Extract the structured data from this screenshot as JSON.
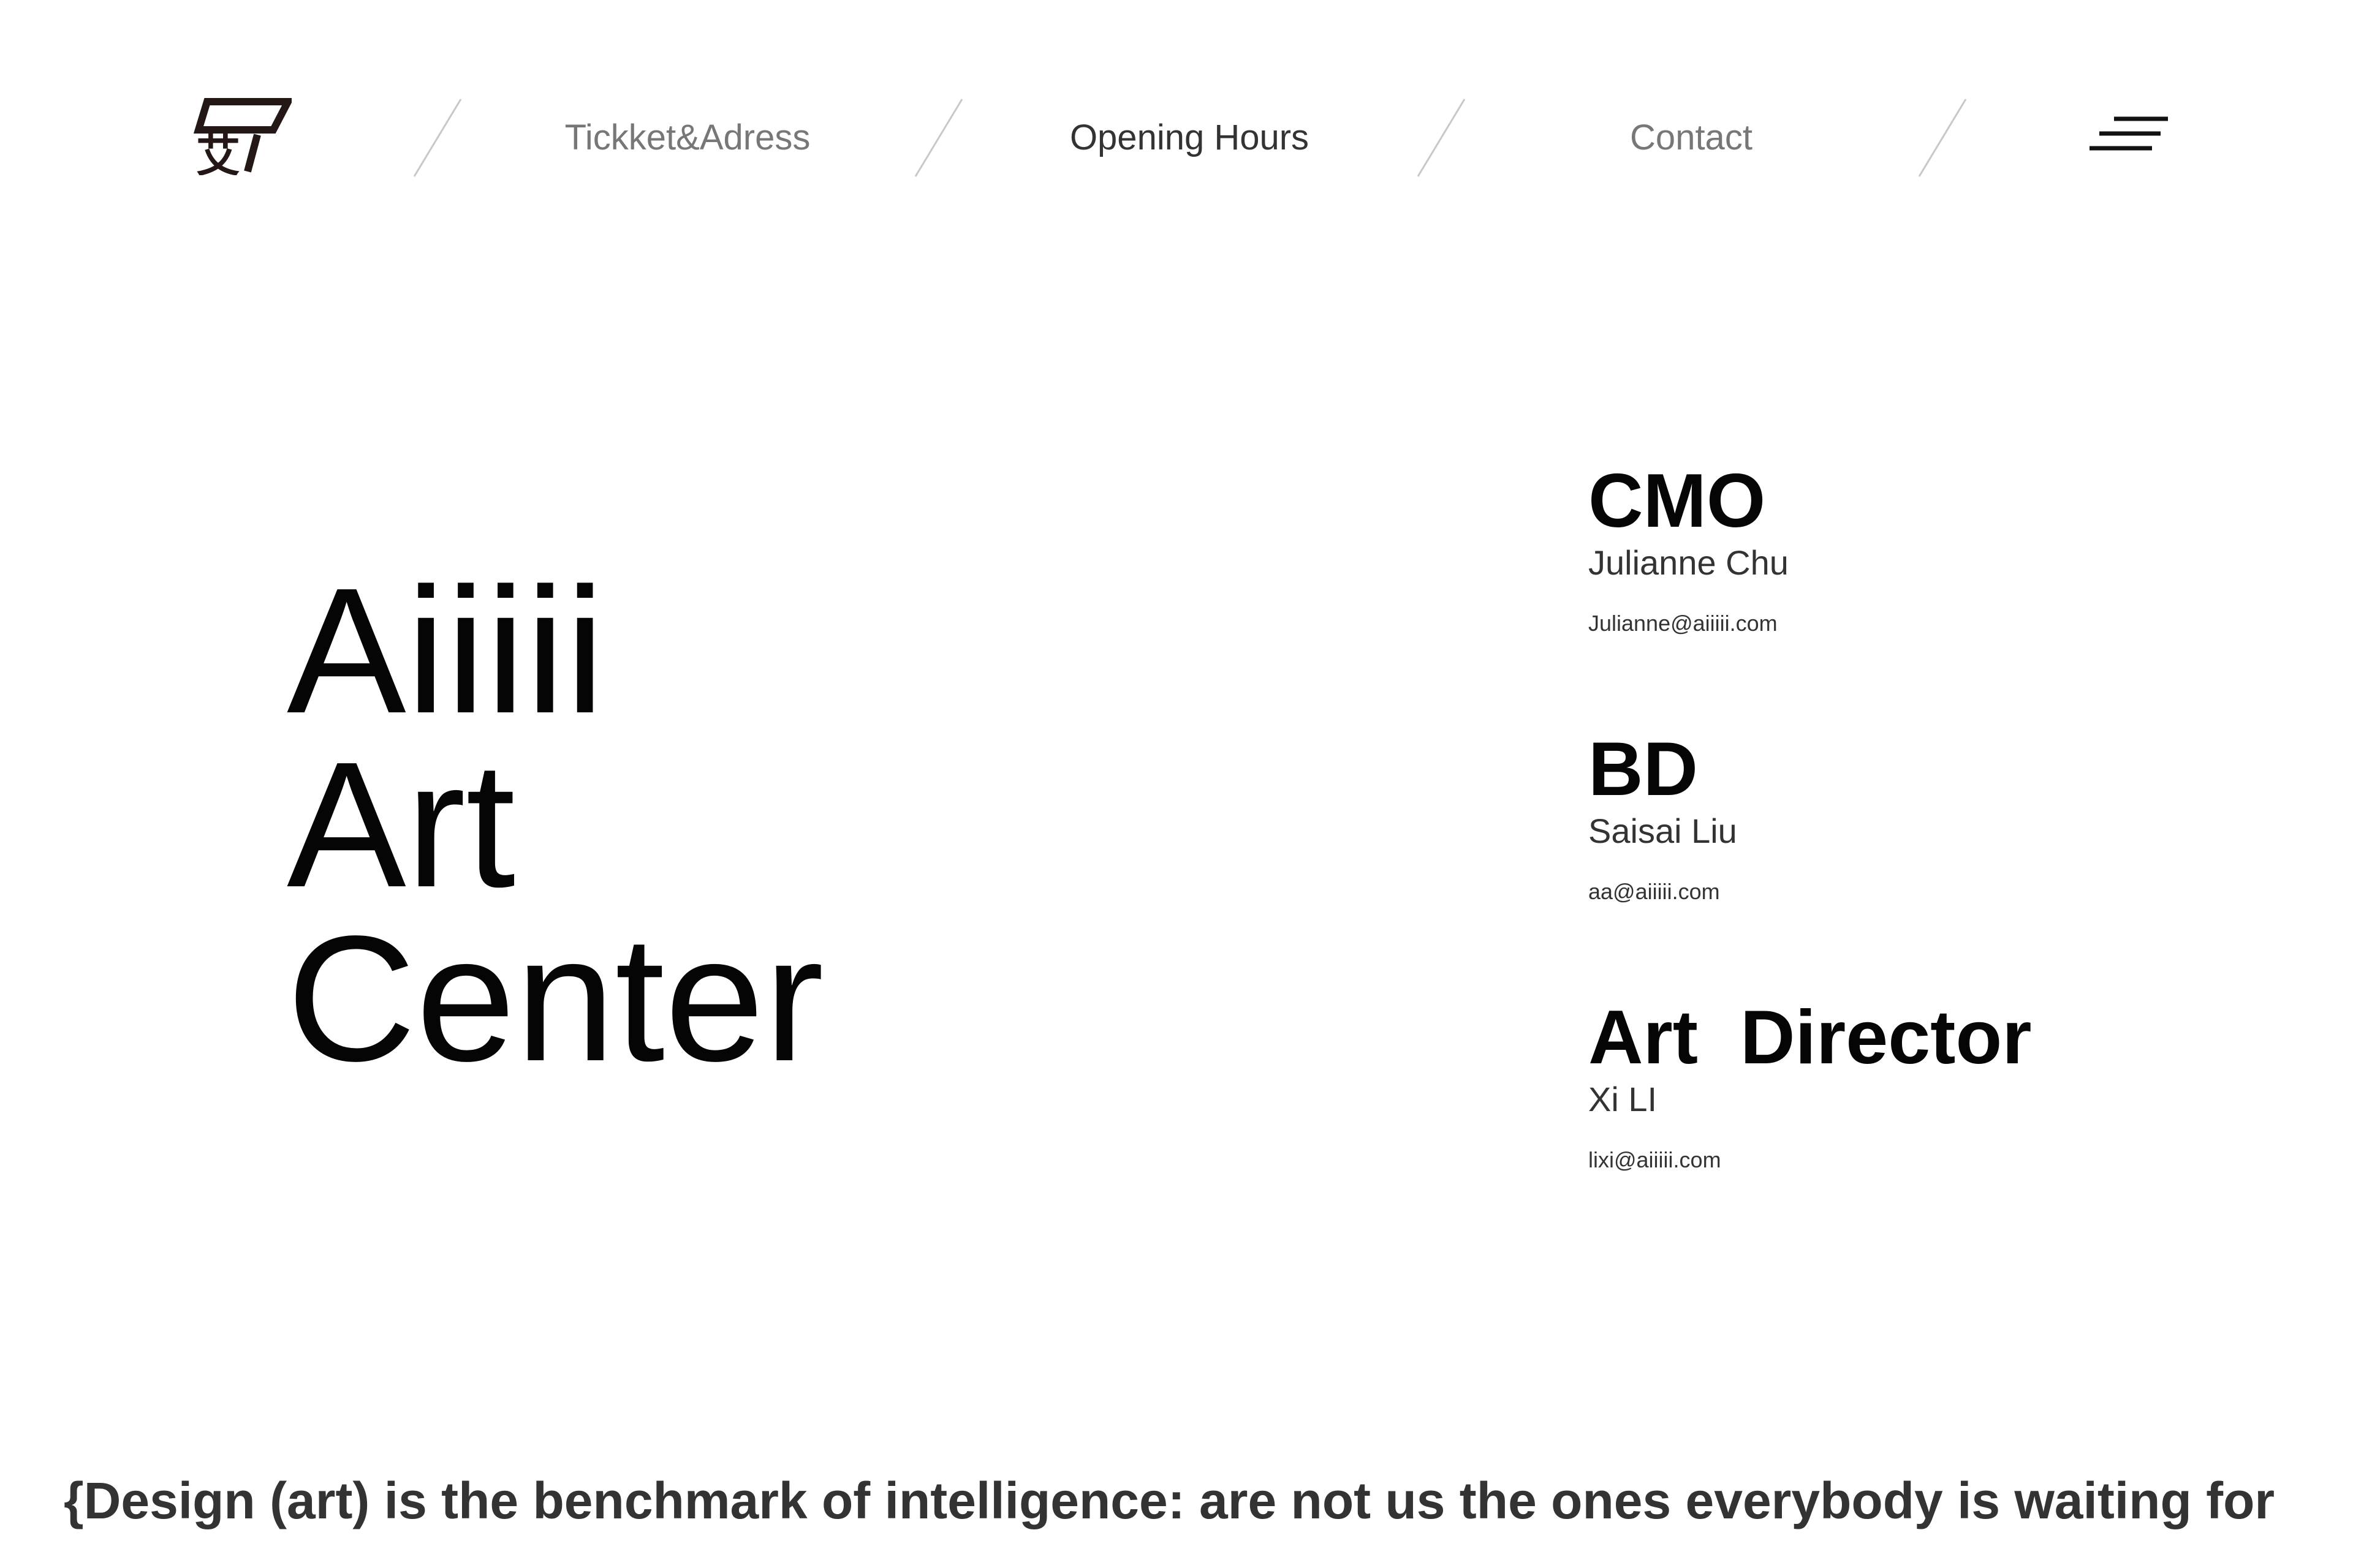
{
  "header": {
    "logo_icon": "brand-logo-icon",
    "nav": [
      {
        "label": "Tickket&Adress",
        "state": "default"
      },
      {
        "label": "Opening Hours",
        "state": "active"
      },
      {
        "label": "Contact",
        "state": "default"
      }
    ],
    "menu_icon": "hamburger-menu-icon"
  },
  "hero": {
    "lines": [
      "Aiiiii",
      "Art",
      "Center"
    ]
  },
  "contacts": [
    {
      "role": "CMO",
      "name": "Julianne Chu",
      "email": "Julianne@aiiiii.com"
    },
    {
      "role": "BD",
      "name": "Saisai Liu",
      "email": "aa@aiiiii.com"
    },
    {
      "role": "Art  Director",
      "name": "Xi LI",
      "email": "lixi@aiiiii.com"
    }
  ],
  "quote": "{Design (art) is the benchmark of intelligence: are not us the ones everybody is waiting for",
  "colors": {
    "text": "#111111",
    "muted": "#777777",
    "divider": "#c8c8c8",
    "background": "#ffffff"
  }
}
